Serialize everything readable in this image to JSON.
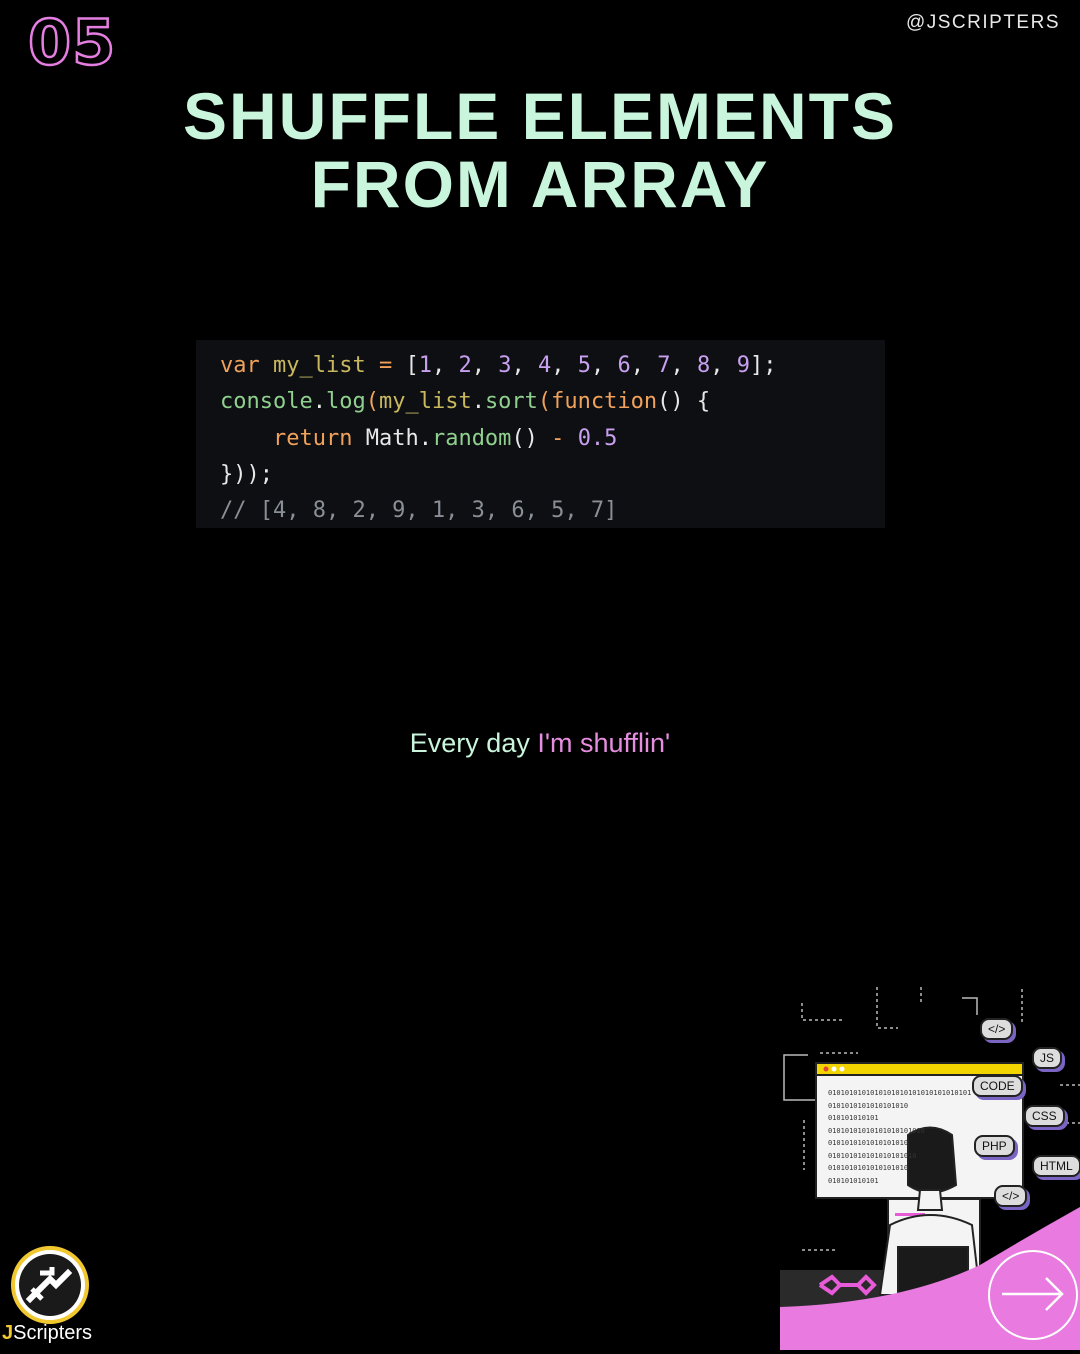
{
  "slide_number": "05",
  "handle": "@JSCRIPTERS",
  "title_line1": "SHUFFLE ELEMENTS",
  "title_line2": "FROM ARRAY",
  "code": {
    "line1": [
      "var",
      " ",
      "my_list",
      " = ",
      "[",
      "1",
      ", ",
      "2",
      ", ",
      "3",
      ", ",
      "4",
      ", ",
      "5",
      ", ",
      "6",
      ", ",
      "7",
      ", ",
      "8",
      ", ",
      "9",
      "];"
    ],
    "line2": [
      "console",
      ".",
      "log",
      "(",
      "my_list",
      ".",
      "sort",
      "(",
      "function",
      "() {"
    ],
    "line3": [
      "    ",
      "return",
      " ",
      "Math",
      ".",
      "random",
      "()",
      " - ",
      "0.5"
    ],
    "line4": "}));",
    "line5": "// [4, 8, 2, 9, 1, 3, 6, 5, 7]"
  },
  "caption": {
    "part1": "Every day ",
    "part2": "I'm shufflin'"
  },
  "logo": {
    "brand_j": "J",
    "brand_rest": "Scripters"
  },
  "illustration_tags": [
    "</>",
    "JS",
    "CODE",
    "CSS",
    "PHP",
    "HTML",
    "</>"
  ],
  "binary_lines": [
    "0101010101010101010101010101010101",
    "0101010101010101010",
    "010101010101",
    "01010101010101010101010",
    "0101010101010101010",
    "010101010101010101010",
    "0101010101010101010",
    "010101010101"
  ],
  "colors": {
    "accent_pink": "#e47ee0",
    "title_mint": "#c8f5dc",
    "brand_yellow": "#f2c830"
  }
}
